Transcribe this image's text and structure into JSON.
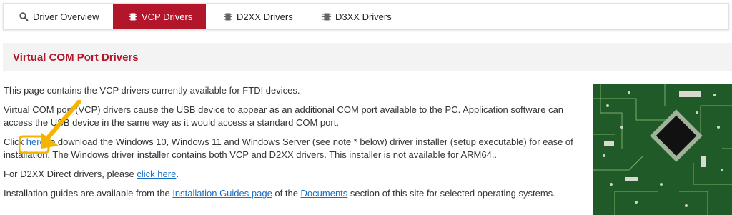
{
  "tabs": [
    {
      "label": "Driver Overview",
      "icon": "search-icon"
    },
    {
      "label": "VCP Drivers",
      "icon": "chip-icon",
      "active": true
    },
    {
      "label": "D2XX Drivers",
      "icon": "chip-icon"
    },
    {
      "label": "D3XX Drivers",
      "icon": "chip-icon"
    }
  ],
  "page_title": "Virtual COM Port Drivers",
  "content": {
    "p1": "This page contains the VCP drivers currently available for FTDI devices.",
    "p2": "Virtual COM port (VCP) drivers cause the USB device to appear as an additional COM port available to the PC.  Application software can access the USB device in the same way as it would access a standard COM port.",
    "p3_before": "Click ",
    "p3_link": "here",
    "p3_after": " to download the Windows 10, Windows 11 and Windows Server (see note * below) driver installer (setup executable) for ease of installation. The Windows driver installer contains both VCP and D2XX drivers. This installer is not available for ARM64..",
    "p4_before": "For D2XX Direct drivers, please ",
    "p4_link": "click here",
    "p4_after": ".",
    "p5_before": "Installation guides are available from the ",
    "p5_link1": "Installation Guides page",
    "p5_mid": " of the ",
    "p5_link2": "Documents",
    "p5_after": " section of this site for selected operating systems."
  },
  "colors": {
    "accent": "#b3162a",
    "link": "#1a6fc4",
    "highlight": "#f5b400"
  },
  "annotation": {
    "type": "arrow-highlight",
    "target": "here-link"
  }
}
